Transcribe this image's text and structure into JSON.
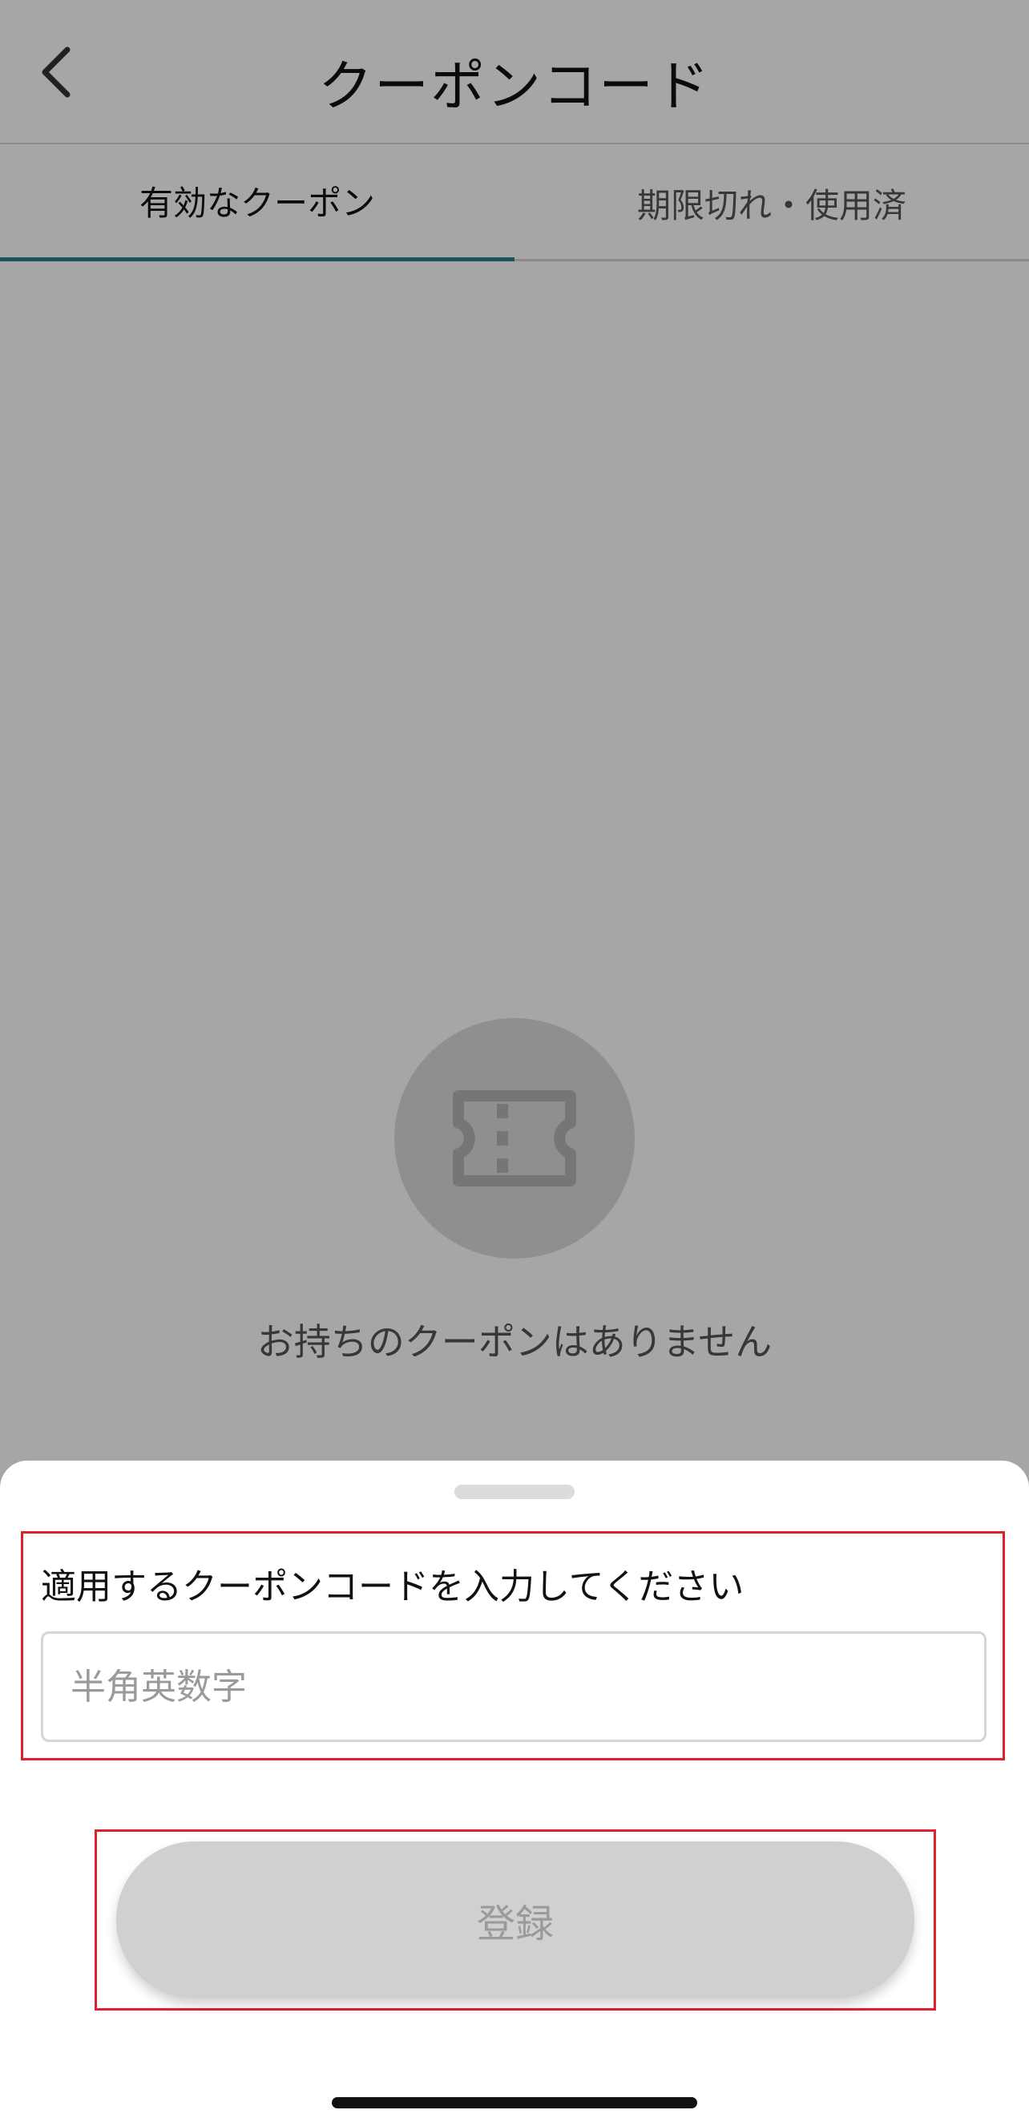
{
  "header": {
    "title": "クーポンコード",
    "back_icon": "chevron-left-icon"
  },
  "tabs": [
    {
      "label": "有効なクーポン",
      "active": true
    },
    {
      "label": "期限切れ・使用済",
      "active": false
    }
  ],
  "empty_state": {
    "icon": "ticket-icon",
    "message": "お持ちのクーポンはありません"
  },
  "sheet": {
    "input_label": "適用するクーポンコードを入力してください",
    "input_value": "",
    "input_placeholder": "半角英数字",
    "submit_label": "登録"
  },
  "colors": {
    "tab_active_underline": "#2f7f86",
    "highlight_border": "#e02030",
    "button_disabled_bg": "#d0d0d0",
    "button_disabled_text": "#9a9a9a"
  }
}
